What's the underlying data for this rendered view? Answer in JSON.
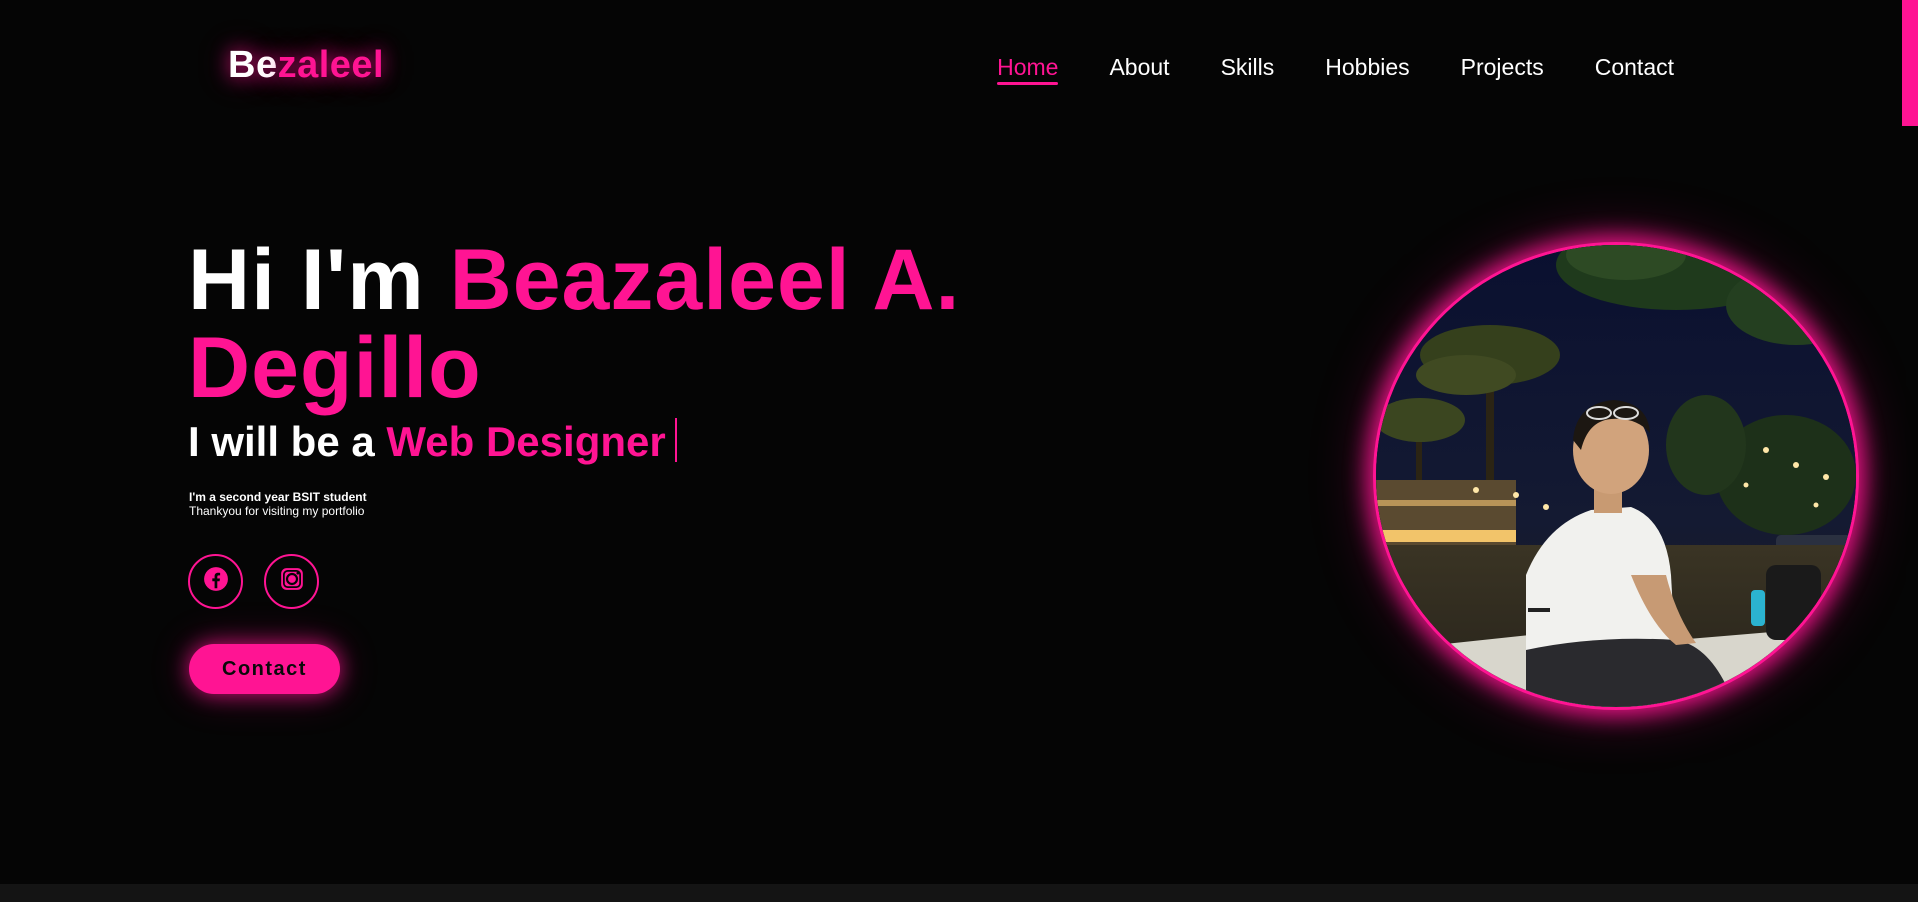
{
  "header": {
    "logo_part1": "Be",
    "logo_part2": "zaleel",
    "nav": [
      {
        "label": "Home",
        "active": true
      },
      {
        "label": "About",
        "active": false
      },
      {
        "label": "Skills",
        "active": false
      },
      {
        "label": "Hobbies",
        "active": false
      },
      {
        "label": "Projects",
        "active": false
      },
      {
        "label": "Contact",
        "active": false
      }
    ]
  },
  "hero": {
    "greeting": "Hi I'm",
    "name_line1": "Beazaleel A.",
    "name_line2": "Degillo",
    "subtitle_prefix": "I will be a",
    "subtitle_role": "Web Designer",
    "desc_line1": "I'm a second year BSIT student",
    "desc_line2": "Thankyou for visiting my portfolio",
    "contact_label": "Contact",
    "socials": [
      {
        "icon": "facebook-icon"
      },
      {
        "icon": "instagram-icon"
      }
    ]
  },
  "colors": {
    "accent": "#ff1493",
    "background": "#050505",
    "text": "#ffffff"
  }
}
